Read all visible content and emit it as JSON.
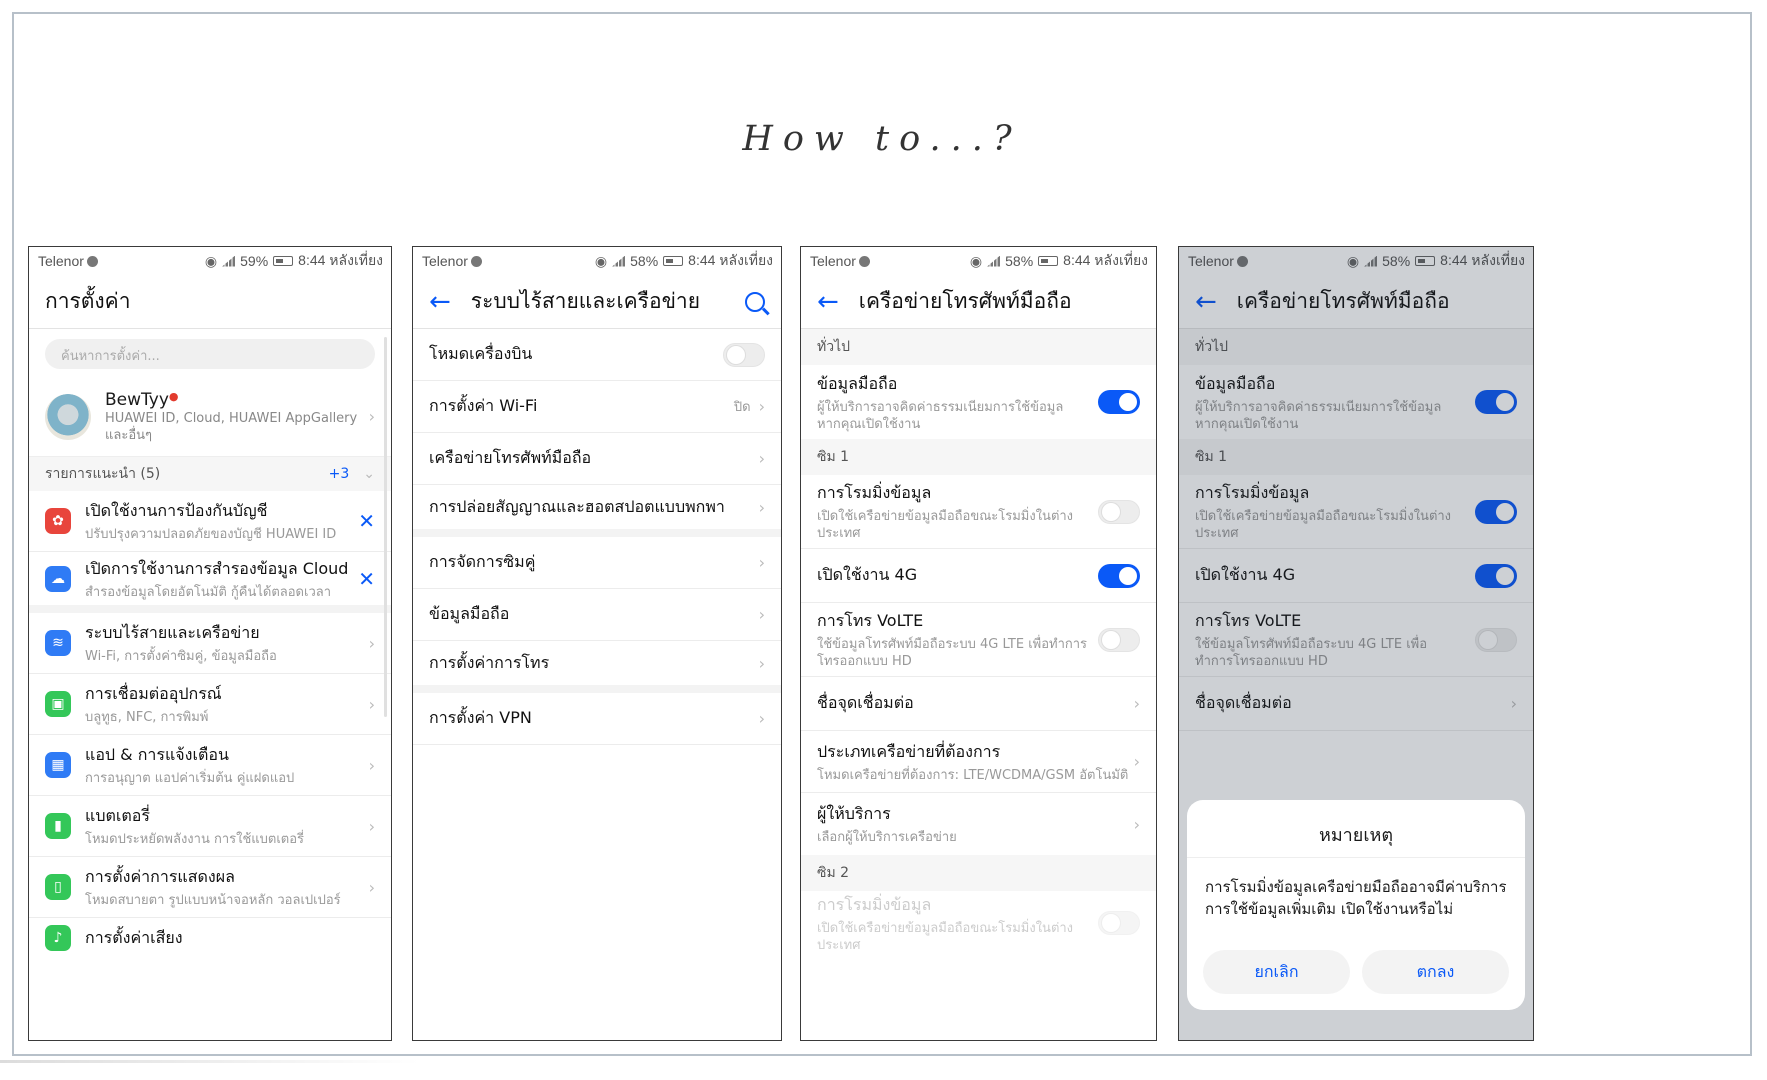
{
  "title": "How to...?",
  "status": {
    "carrier": "Telenor",
    "p1_batt": "59%",
    "batt": "58%",
    "time": "8:44 หลังเที่ยง"
  },
  "s1": {
    "title": "การตั้งค่า",
    "search_placeholder": "ค้นหาการตั้งค่า...",
    "account": {
      "name": "BewTyy",
      "sub": "HUAWEI ID, Cloud, HUAWEI AppGallery และอื่นๆ"
    },
    "suggest_label": "รายการแนะนำ (5)",
    "suggest_more": "+3",
    "suggestions": [
      {
        "l1": "เปิดใช้งานการป้องกันบัญชี",
        "l2": "ปรับปรุงความปลอดภัยของบัญชี HUAWEI ID"
      },
      {
        "l1": "เปิดการใช้งานการสำรองข้อมูล Cloud",
        "l2": "สำรองข้อมูลโดยอัตโนมัติ กู้คืนได้ตลอดเวลา"
      }
    ],
    "items": [
      {
        "l1": "ระบบไร้สายและเครือข่าย",
        "l2": "Wi-Fi, การตั้งค่าซิมคู่, ข้อมูลมือถือ"
      },
      {
        "l1": "การเชื่อมต่ออุปกรณ์",
        "l2": "บลูทูธ, NFC, การพิมพ์"
      },
      {
        "l1": "แอป & การแจ้งเตือน",
        "l2": "การอนุญาต แอปค่าเริ่มต้น คู่แฝดแอป"
      },
      {
        "l1": "แบตเตอรี่",
        "l2": "โหมดประหยัดพลังงาน การใช้แบตเตอรี่"
      },
      {
        "l1": "การตั้งค่าการแสดงผล",
        "l2": "โหมดสบายตา รูปแบบหน้าจอหลัก วอลเปเปอร์"
      },
      {
        "l1": "การตั้งค่าเสียง",
        "l2": ""
      }
    ]
  },
  "s2": {
    "title": "ระบบไร้สายและเครือข่าย",
    "airplane": "โหมดเครื่องบิน",
    "wifi": "การตั้งค่า Wi-Fi",
    "wifi_val": "ปิด",
    "mobile_net": "เครือข่ายโทรศัพท์มือถือ",
    "hotspot": "การปล่อยสัญญาณและฮอตสปอตแบบพกพา",
    "sim": "การจัดการซิมคู่",
    "data": "ข้อมูลมือถือ",
    "call": "การตั้งค่าการโทร",
    "vpn": "การตั้งค่า VPN"
  },
  "s3": {
    "title": "เครือข่ายโทรศัพท์มือถือ",
    "general": "ทั่วไป",
    "mobile_data": "ข้อมูลมือถือ",
    "mobile_data_sub": "ผู้ให้บริการอาจคิดค่าธรรมเนียมการใช้ข้อมูล หากคุณเปิดใช้งาน",
    "sim1": "ซิม 1",
    "roaming": "การโรมมิ่งข้อมูล",
    "roaming_sub": "เปิดใช้เครือข่ายข้อมูลมือถือขณะโรมมิ่งในต่างประเทศ",
    "lte": "เปิดใช้งาน 4G",
    "volte": "การโทร VoLTE",
    "volte_sub": "ใช้ข้อมูลโทรศัพท์มือถือระบบ 4G LTE เพื่อทำการโทรออกแบบ HD",
    "apn": "ชื่อจุดเชื่อมต่อ",
    "net_type": "ประเภทเครือข่ายที่ต้องการ",
    "net_type_sub": "โหมดเครือข่ายที่ต้องการ: LTE/WCDMA/GSM อัตโนมัติ",
    "carrier": "ผู้ให้บริการ",
    "carrier_sub": "เลือกผู้ให้บริการเครือข่าย",
    "sim2": "ซิม 2"
  },
  "dialog": {
    "title": "หมายเหตุ",
    "body": "การโรมมิ่งข้อมูลเครือข่ายมือถืออาจมีค่าบริการการใช้ข้อมูลเพิ่มเติม เปิดใช้งานหรือไม่",
    "cancel": "ยกเลิก",
    "ok": "ตกลง"
  },
  "colors": {
    "accent": "#0a59f7",
    "huawei_red": "#e8453c",
    "cloud_blue": "#2f7bf5",
    "green": "#34c759"
  }
}
